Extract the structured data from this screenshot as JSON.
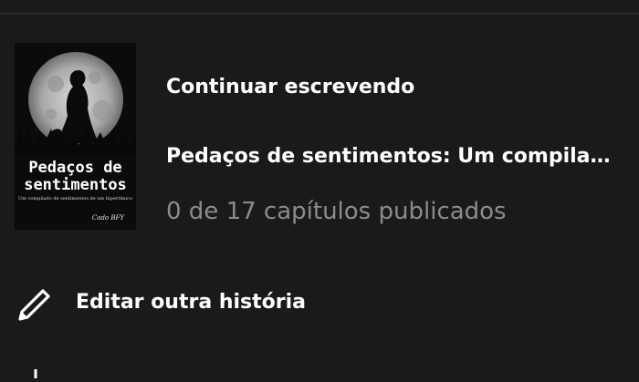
{
  "continue_writing": {
    "label": "Continuar escrevendo",
    "story_title": "Pedaços de sentimentos: Um compilado de sentimentos de um hipertímico",
    "progress_text": "0 de 17 capítulos publicados",
    "cover": {
      "title_line1": "Pedaços de",
      "title_line2": "sentimentos",
      "subtitle": "Um compilado de sentimentos de um hipertímico",
      "author": "Cado BFY"
    }
  },
  "menu": {
    "edit_other_story": "Editar outra história",
    "edit_icon": "pencil-icon",
    "next_icon": "plus-icon"
  },
  "colors": {
    "background": "#1b1a1a",
    "divider": "#2c2b2b",
    "primary_text": "#ffffff",
    "secondary_text": "#8c8b8b"
  }
}
